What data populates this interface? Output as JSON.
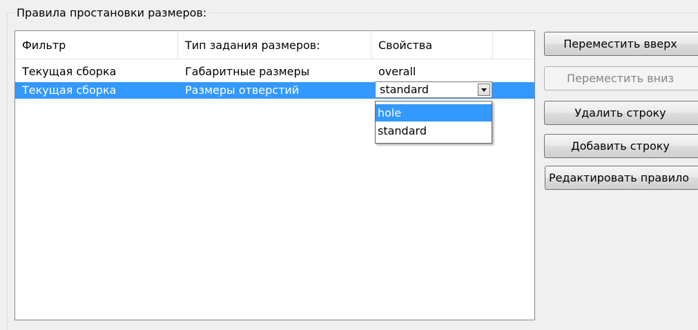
{
  "group": {
    "title": "Правила простановки размеров:"
  },
  "table": {
    "columns": [
      "Фильтр",
      "Тип задания размеров:",
      "Свойства"
    ],
    "rows": [
      {
        "filter": "Текущая сборка",
        "type": "Габаритные размеры",
        "props": "overall",
        "selected": false
      },
      {
        "filter": "Текущая сборка",
        "type": "Размеры отверстий",
        "props": "standard",
        "selected": true
      }
    ]
  },
  "combo": {
    "value": "standard",
    "options": [
      "hole",
      "standard"
    ],
    "highlighted": "hole",
    "icon": "chevron-down-icon"
  },
  "buttons": {
    "move_up": "Переместить вверх",
    "move_down": "Переместить вниз",
    "delete_row": "Удалить строку",
    "add_row": "Добавить строку",
    "edit_rule": "Редактировать правило"
  },
  "colors": {
    "selection": "#3399ff",
    "background": "#f0f0f0"
  }
}
